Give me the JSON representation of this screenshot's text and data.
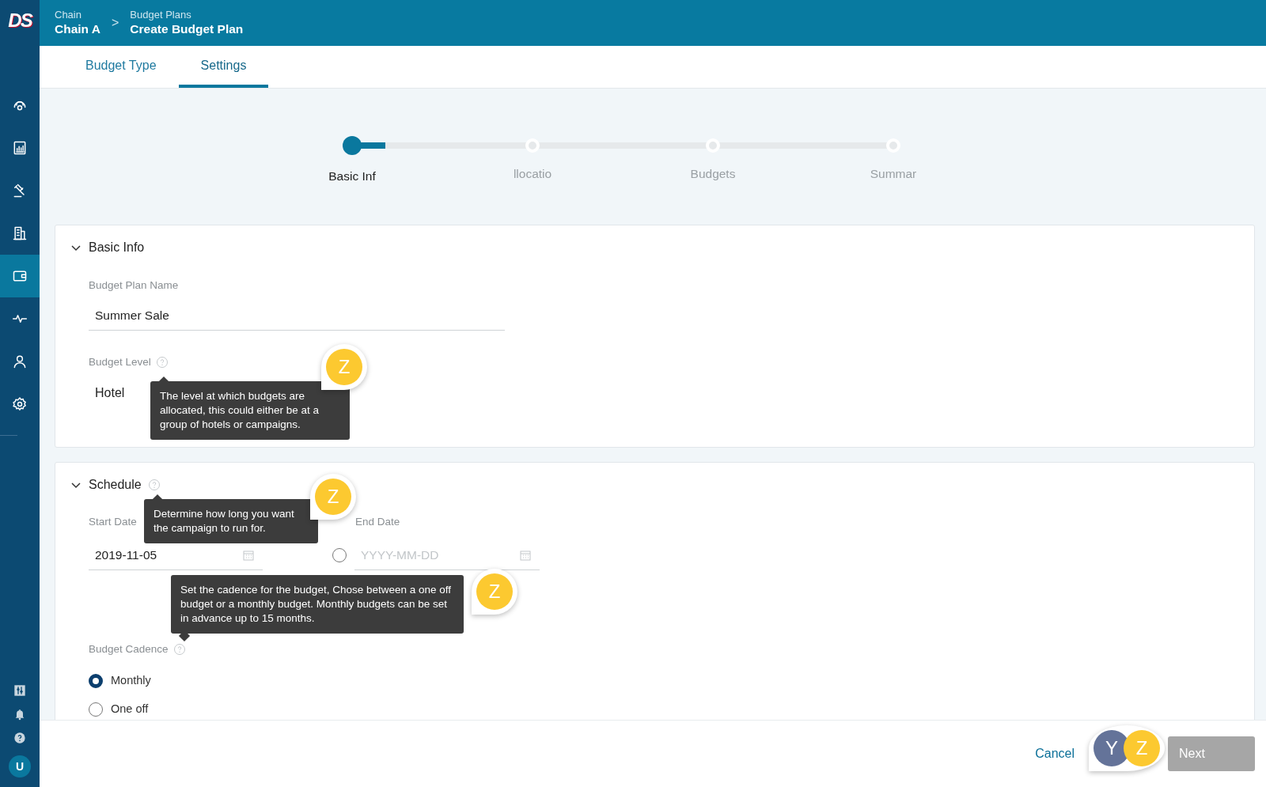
{
  "logo": "DS",
  "breadcrumb": [
    {
      "caption": "Chain",
      "title": "Chain A"
    },
    {
      "caption": "Budget Plans",
      "title": "Create Budget Plan"
    }
  ],
  "breadcrumb_separator": ">",
  "sidebar": {
    "items": [
      {
        "selected": false
      },
      {
        "selected": false
      },
      {
        "selected": false
      },
      {
        "selected": false
      },
      {
        "selected": true
      },
      {
        "selected": false
      },
      {
        "selected": false
      },
      {
        "selected": false
      }
    ],
    "avatar": "U"
  },
  "tabs": [
    {
      "label": "Budget Type",
      "selected": false
    },
    {
      "label": "Settings",
      "selected": true
    }
  ],
  "stepper": {
    "steps": [
      {
        "label": "Basic Inf",
        "selected": true
      },
      {
        "label": "llocatio",
        "selected": false
      },
      {
        "label": "Budgets",
        "selected": false
      },
      {
        "label": "Summar",
        "selected": false
      }
    ]
  },
  "basic_info": {
    "title": "Basic Info",
    "expanded": true,
    "plan_name": {
      "label": "Budget Plan Name",
      "value": "Summer Sale"
    },
    "level": {
      "label": "Budget Level",
      "value": "Hotel"
    },
    "tooltip": {
      "text": "The level at which budgets are allocated, this could either be at a group of hotels or campaigns.",
      "comment": "Z"
    }
  },
  "schedule": {
    "title": "Schedule",
    "expanded": true,
    "tooltip": {
      "text": "Determine how long you want the campaign to run for.",
      "comment": "Z"
    },
    "start_date": {
      "label": "Start Date",
      "value": "2019-11-05"
    },
    "end_date": {
      "label": "End Date",
      "placeholder": "YYYY-MM-DD",
      "checked": false
    },
    "cadence": {
      "label": "Budget Cadence",
      "tooltip": {
        "text": "Set the cadence for the budget, Chose between a one off budget or a monthly budget. Monthly budgets can be set in advance up to 15 months.",
        "comment": "Z"
      },
      "options": [
        {
          "label": "Monthly",
          "selected": true
        },
        {
          "label": "One off",
          "selected": false
        }
      ]
    }
  },
  "footer": {
    "cancel": "Cancel",
    "next": {
      "label": "Next",
      "disabled": true
    },
    "comments": [
      {
        "initials": "Y",
        "color": "#647399"
      },
      {
        "initials": "Z",
        "color": "#fcc930"
      }
    ]
  }
}
